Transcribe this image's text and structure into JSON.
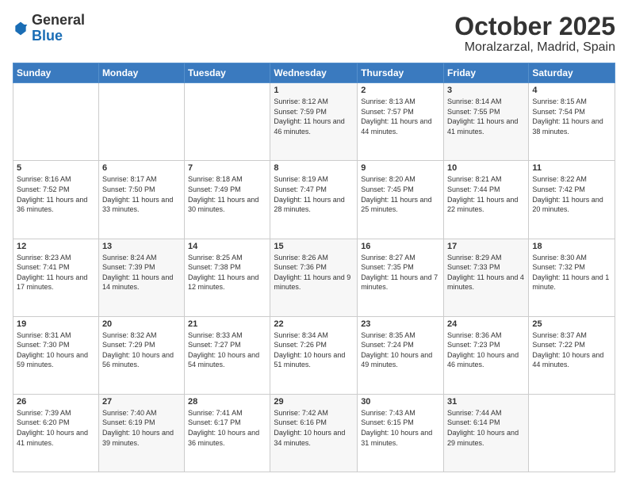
{
  "logo": {
    "general": "General",
    "blue": "Blue"
  },
  "title": "October 2025",
  "subtitle": "Moralzarzal, Madrid, Spain",
  "days_of_week": [
    "Sunday",
    "Monday",
    "Tuesday",
    "Wednesday",
    "Thursday",
    "Friday",
    "Saturday"
  ],
  "weeks": [
    [
      {
        "day": "",
        "info": ""
      },
      {
        "day": "",
        "info": ""
      },
      {
        "day": "",
        "info": ""
      },
      {
        "day": "1",
        "info": "Sunrise: 8:12 AM\nSunset: 7:59 PM\nDaylight: 11 hours and 46 minutes."
      },
      {
        "day": "2",
        "info": "Sunrise: 8:13 AM\nSunset: 7:57 PM\nDaylight: 11 hours and 44 minutes."
      },
      {
        "day": "3",
        "info": "Sunrise: 8:14 AM\nSunset: 7:55 PM\nDaylight: 11 hours and 41 minutes."
      },
      {
        "day": "4",
        "info": "Sunrise: 8:15 AM\nSunset: 7:54 PM\nDaylight: 11 hours and 38 minutes."
      }
    ],
    [
      {
        "day": "5",
        "info": "Sunrise: 8:16 AM\nSunset: 7:52 PM\nDaylight: 11 hours and 36 minutes."
      },
      {
        "day": "6",
        "info": "Sunrise: 8:17 AM\nSunset: 7:50 PM\nDaylight: 11 hours and 33 minutes."
      },
      {
        "day": "7",
        "info": "Sunrise: 8:18 AM\nSunset: 7:49 PM\nDaylight: 11 hours and 30 minutes."
      },
      {
        "day": "8",
        "info": "Sunrise: 8:19 AM\nSunset: 7:47 PM\nDaylight: 11 hours and 28 minutes."
      },
      {
        "day": "9",
        "info": "Sunrise: 8:20 AM\nSunset: 7:45 PM\nDaylight: 11 hours and 25 minutes."
      },
      {
        "day": "10",
        "info": "Sunrise: 8:21 AM\nSunset: 7:44 PM\nDaylight: 11 hours and 22 minutes."
      },
      {
        "day": "11",
        "info": "Sunrise: 8:22 AM\nSunset: 7:42 PM\nDaylight: 11 hours and 20 minutes."
      }
    ],
    [
      {
        "day": "12",
        "info": "Sunrise: 8:23 AM\nSunset: 7:41 PM\nDaylight: 11 hours and 17 minutes."
      },
      {
        "day": "13",
        "info": "Sunrise: 8:24 AM\nSunset: 7:39 PM\nDaylight: 11 hours and 14 minutes."
      },
      {
        "day": "14",
        "info": "Sunrise: 8:25 AM\nSunset: 7:38 PM\nDaylight: 11 hours and 12 minutes."
      },
      {
        "day": "15",
        "info": "Sunrise: 8:26 AM\nSunset: 7:36 PM\nDaylight: 11 hours and 9 minutes."
      },
      {
        "day": "16",
        "info": "Sunrise: 8:27 AM\nSunset: 7:35 PM\nDaylight: 11 hours and 7 minutes."
      },
      {
        "day": "17",
        "info": "Sunrise: 8:29 AM\nSunset: 7:33 PM\nDaylight: 11 hours and 4 minutes."
      },
      {
        "day": "18",
        "info": "Sunrise: 8:30 AM\nSunset: 7:32 PM\nDaylight: 11 hours and 1 minute."
      }
    ],
    [
      {
        "day": "19",
        "info": "Sunrise: 8:31 AM\nSunset: 7:30 PM\nDaylight: 10 hours and 59 minutes."
      },
      {
        "day": "20",
        "info": "Sunrise: 8:32 AM\nSunset: 7:29 PM\nDaylight: 10 hours and 56 minutes."
      },
      {
        "day": "21",
        "info": "Sunrise: 8:33 AM\nSunset: 7:27 PM\nDaylight: 10 hours and 54 minutes."
      },
      {
        "day": "22",
        "info": "Sunrise: 8:34 AM\nSunset: 7:26 PM\nDaylight: 10 hours and 51 minutes."
      },
      {
        "day": "23",
        "info": "Sunrise: 8:35 AM\nSunset: 7:24 PM\nDaylight: 10 hours and 49 minutes."
      },
      {
        "day": "24",
        "info": "Sunrise: 8:36 AM\nSunset: 7:23 PM\nDaylight: 10 hours and 46 minutes."
      },
      {
        "day": "25",
        "info": "Sunrise: 8:37 AM\nSunset: 7:22 PM\nDaylight: 10 hours and 44 minutes."
      }
    ],
    [
      {
        "day": "26",
        "info": "Sunrise: 7:39 AM\nSunset: 6:20 PM\nDaylight: 10 hours and 41 minutes."
      },
      {
        "day": "27",
        "info": "Sunrise: 7:40 AM\nSunset: 6:19 PM\nDaylight: 10 hours and 39 minutes."
      },
      {
        "day": "28",
        "info": "Sunrise: 7:41 AM\nSunset: 6:17 PM\nDaylight: 10 hours and 36 minutes."
      },
      {
        "day": "29",
        "info": "Sunrise: 7:42 AM\nSunset: 6:16 PM\nDaylight: 10 hours and 34 minutes."
      },
      {
        "day": "30",
        "info": "Sunrise: 7:43 AM\nSunset: 6:15 PM\nDaylight: 10 hours and 31 minutes."
      },
      {
        "day": "31",
        "info": "Sunrise: 7:44 AM\nSunset: 6:14 PM\nDaylight: 10 hours and 29 minutes."
      },
      {
        "day": "",
        "info": ""
      }
    ]
  ]
}
